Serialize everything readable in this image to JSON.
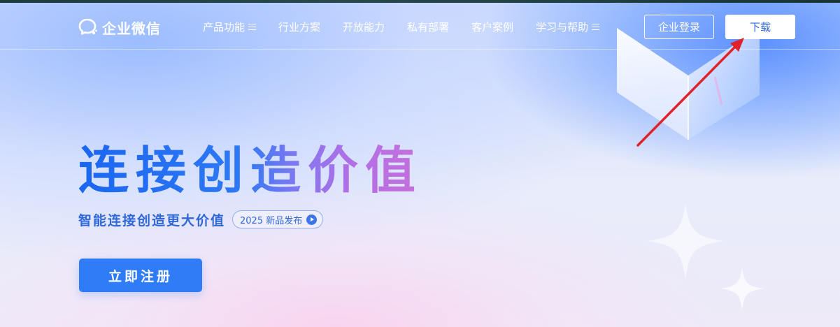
{
  "brand": {
    "name": "企业微信"
  },
  "nav": {
    "items": [
      {
        "label": "产品功能",
        "has_menu": true
      },
      {
        "label": "行业方案",
        "has_menu": false
      },
      {
        "label": "开放能力",
        "has_menu": false
      },
      {
        "label": "私有部署",
        "has_menu": false
      },
      {
        "label": "客户案例",
        "has_menu": false
      },
      {
        "label": "学习与帮助",
        "has_menu": true
      }
    ],
    "login_label": "企业登录",
    "download_label": "下载"
  },
  "hero": {
    "title": "连接创造价值",
    "subtitle": "智能连接创造更大价值",
    "badge_label": "2025 新品发布",
    "register_label": "立即注册"
  },
  "colors": {
    "primary": "#2f7cf6",
    "title_gradient_start": "#1a66f0",
    "title_gradient_end": "#c66fdc",
    "annotation_arrow": "#e0222b"
  }
}
